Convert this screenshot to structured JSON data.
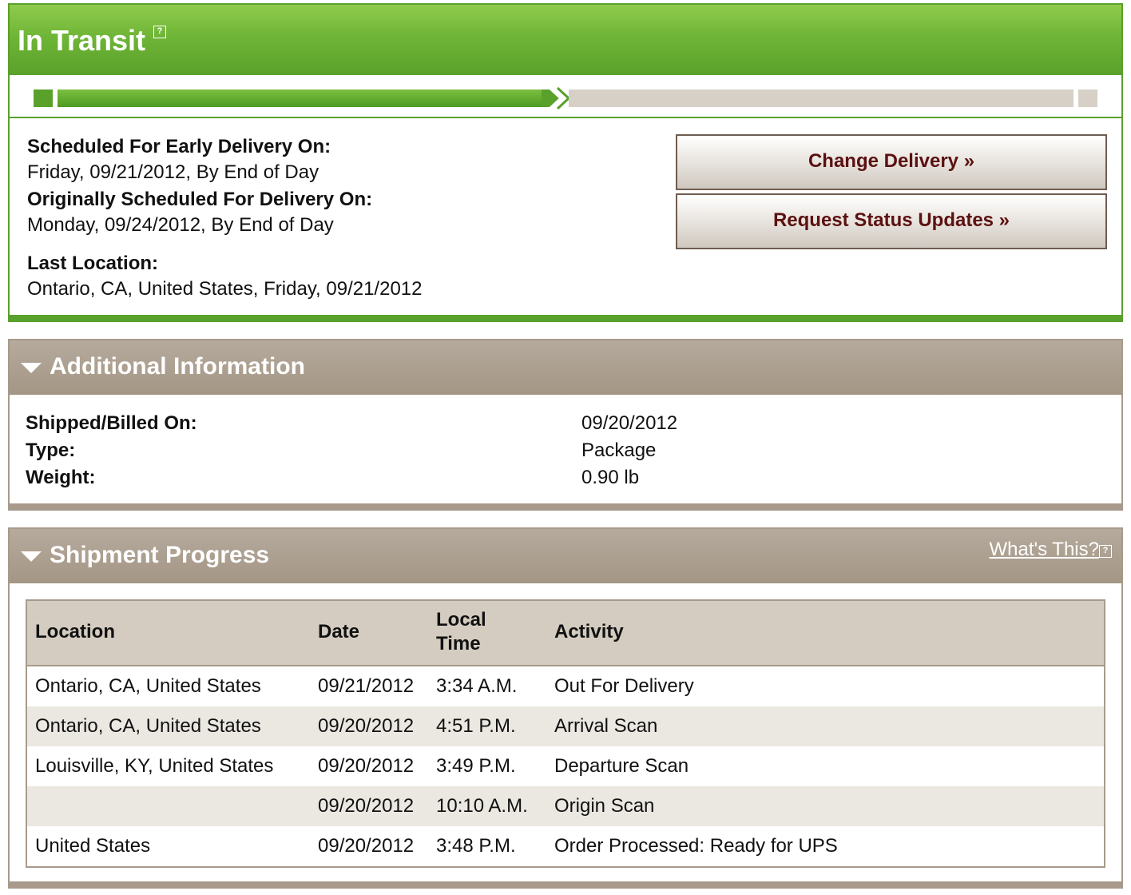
{
  "status": {
    "title": "In Transit",
    "help_icon": "help-icon",
    "progress_fraction": 0.5
  },
  "delivery": {
    "early_label": "Scheduled For Early Delivery On:",
    "early_value": "Friday, 09/21/2012, By End of Day",
    "original_label": "Originally Scheduled For Delivery On:",
    "original_value": "Monday, 09/24/2012, By End of Day",
    "last_location_label": "Last Location:",
    "last_location_value": "Ontario, CA, United States, Friday, 09/21/2012"
  },
  "buttons": {
    "change_delivery": "Change Delivery »",
    "request_updates": "Request Status Updates »"
  },
  "additional_info": {
    "title": "Additional Information",
    "rows": [
      {
        "label": "Shipped/Billed On:",
        "value": "09/20/2012"
      },
      {
        "label": "Type:",
        "value": "Package"
      },
      {
        "label": "Weight:",
        "value": "0.90 lb"
      }
    ]
  },
  "shipment_progress": {
    "title": "Shipment Progress",
    "whats_this": "What's This?",
    "columns": [
      "Location",
      "Date",
      "Local Time",
      "Activity"
    ],
    "rows": [
      {
        "location": "Ontario, CA, United States",
        "date": "09/21/2012",
        "time": "3:34 A.M.",
        "activity": "Out For Delivery"
      },
      {
        "location": "Ontario, CA, United States",
        "date": "09/20/2012",
        "time": "4:51 P.M.",
        "activity": "Arrival Scan"
      },
      {
        "location": "Louisville, KY, United States",
        "date": "09/20/2012",
        "time": "3:49 P.M.",
        "activity": "Departure Scan"
      },
      {
        "location": "",
        "date": "09/20/2012",
        "time": "10:10 A.M.",
        "activity": "Origin Scan"
      },
      {
        "location": "United States",
        "date": "09/20/2012",
        "time": "3:48 P.M.",
        "activity": "Order Processed: Ready for UPS"
      }
    ]
  },
  "colors": {
    "green": "#5aa12b",
    "taupe": "#a89a8b",
    "button_text": "#5c1010"
  }
}
